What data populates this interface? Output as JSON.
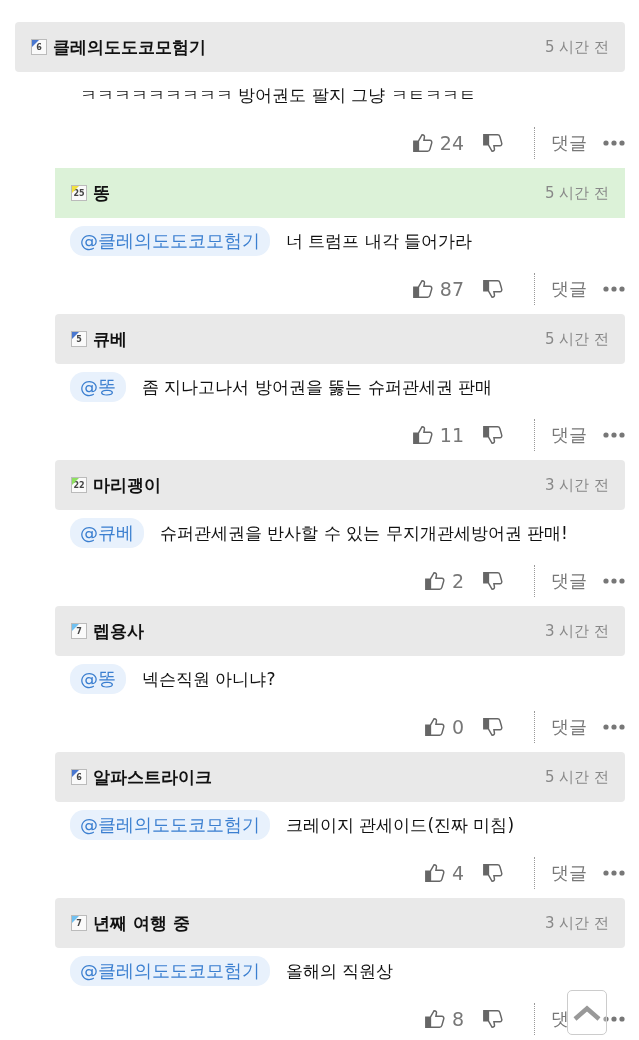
{
  "comments": [
    {
      "level": "6",
      "color": "#4a78d0",
      "author": "클레의도도코모험기",
      "time": "5 시간 전",
      "highlighted": false,
      "reply": false,
      "text": "ㅋㅋㅋㅋㅋㅋㅋㅋㅋ 방어권도 팔지 그냥 ㅋㅌㅋㅋㅌ",
      "likes": "24",
      "reply_label": "댓글"
    },
    {
      "level": "25",
      "color": "#f0e040",
      "author": "똥",
      "time": "5 시간 전",
      "highlighted": true,
      "reply": true,
      "mention": "@클레의도도코모험기",
      "text": "너 트럼프 내각 들어가라",
      "likes": "87",
      "reply_label": "댓글"
    },
    {
      "level": "5",
      "color": "#4a78d0",
      "author": "큐베",
      "time": "5 시간 전",
      "highlighted": false,
      "reply": true,
      "mention": "@똥",
      "text": "좀 지나고나서 방어권을 뚫는 슈퍼관세권 판매",
      "likes": "11",
      "reply_label": "댓글"
    },
    {
      "level": "22",
      "color": "#8ee060",
      "author": "마리괭이",
      "time": "3 시간 전",
      "highlighted": false,
      "reply": true,
      "mention": "@큐베",
      "text": "슈퍼관세권을 반사할 수 있는 무지개관세방어권 판매!",
      "likes": "2",
      "reply_label": "댓글"
    },
    {
      "level": "7",
      "color": "#70c0f0",
      "author": "렙용사",
      "time": "3 시간 전",
      "highlighted": false,
      "reply": true,
      "mention": "@똥",
      "text": "넥슨직원 아니냐?",
      "likes": "0",
      "reply_label": "댓글"
    },
    {
      "level": "6",
      "color": "#4a78d0",
      "author": "알파스트라이크",
      "time": "5 시간 전",
      "highlighted": false,
      "reply": true,
      "mention": "@클레의도도코모험기",
      "text": "크레이지 관세이드(진짜 미침)",
      "likes": "4",
      "reply_label": "댓글"
    },
    {
      "level": "7",
      "color": "#70c0f0",
      "author": "년째 여행 중",
      "time": "3 시간 전",
      "highlighted": false,
      "reply": true,
      "mention": "@클레의도도코모험기",
      "text": "올해의 직원상",
      "likes": "8",
      "reply_label": "댓"
    }
  ]
}
